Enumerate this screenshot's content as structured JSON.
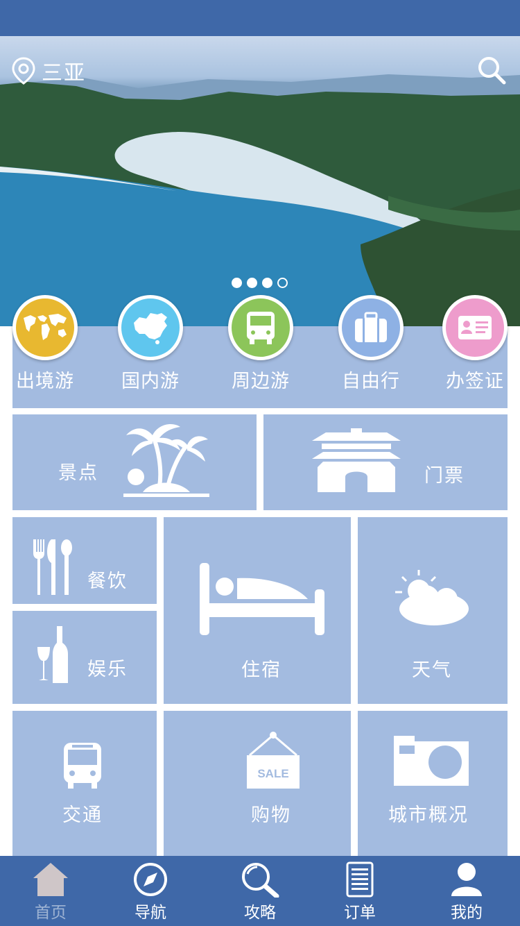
{
  "location": {
    "city": "三亚"
  },
  "banner": {
    "page_count": 4,
    "active_index": 3
  },
  "categories": [
    {
      "label": "出境游",
      "icon": "world-map-icon",
      "color": "#e8b830"
    },
    {
      "label": "国内游",
      "icon": "china-map-icon",
      "color": "#5fc6ee"
    },
    {
      "label": "周边游",
      "icon": "bus-icon",
      "color": "#8cc55a"
    },
    {
      "label": "自由行",
      "icon": "suitcase-icon",
      "color": "#8eb1e4"
    },
    {
      "label": "办签证",
      "icon": "id-card-icon",
      "color": "#ee9ccc"
    }
  ],
  "tiles": {
    "scenic": "景点",
    "tickets": "门票",
    "dining": "餐饮",
    "entertainment": "娱乐",
    "lodging": "住宿",
    "weather": "天气",
    "transport": "交通",
    "shopping": "购物",
    "city_overview": "城市概况"
  },
  "tabs": [
    {
      "label": "首页",
      "icon": "home-icon",
      "active": true
    },
    {
      "label": "导航",
      "icon": "compass-icon",
      "active": false
    },
    {
      "label": "攻略",
      "icon": "magnifier-icon",
      "active": false
    },
    {
      "label": "订单",
      "icon": "order-list-icon",
      "active": false
    },
    {
      "label": "我的",
      "icon": "user-icon",
      "active": false
    }
  ],
  "colors": {
    "primary": "#3f68a8",
    "tile": "#a3bbe0",
    "tab_inactive": "#9fb4d3"
  }
}
